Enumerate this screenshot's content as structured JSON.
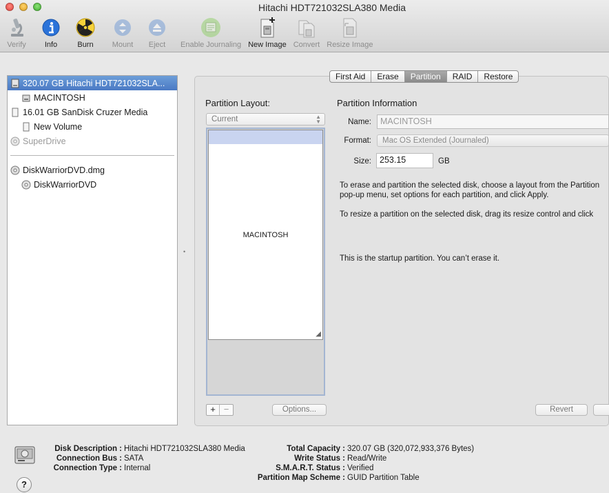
{
  "window": {
    "title": "Hitachi HDT721032SLA380 Media"
  },
  "toolbar": {
    "items": [
      {
        "label": "Verify",
        "icon": "microscope-icon",
        "enabled": false
      },
      {
        "label": "Info",
        "icon": "info-icon",
        "enabled": true
      },
      {
        "label": "Burn",
        "icon": "burn-radiation-icon",
        "enabled": true
      },
      {
        "label": "Mount",
        "icon": "mount-icon",
        "enabled": false
      },
      {
        "label": "Eject",
        "icon": "eject-icon",
        "enabled": false
      },
      {
        "label": "Enable Journaling",
        "icon": "journaling-icon",
        "enabled": false
      },
      {
        "label": "New Image",
        "icon": "new-image-icon",
        "enabled": true
      },
      {
        "label": "Convert",
        "icon": "convert-icon",
        "enabled": false
      },
      {
        "label": "Resize Image",
        "icon": "resize-image-icon",
        "enabled": false
      }
    ]
  },
  "sidebar": {
    "items": [
      {
        "label": "320.07 GB Hitachi HDT721032SLA...",
        "level": 0,
        "selected": true,
        "icon": "hard-disk-icon"
      },
      {
        "label": "MACINTOSH",
        "level": 1,
        "icon": "volume-icon"
      },
      {
        "label": "16.01 GB SanDisk Cruzer Media",
        "level": 0,
        "icon": "usb-disk-icon"
      },
      {
        "label": "New Volume",
        "level": 1,
        "icon": "volume-icon"
      },
      {
        "label": "SuperDrive",
        "level": 0,
        "dim": true,
        "icon": "optical-drive-icon"
      },
      {
        "label": "DiskWarriorDVD.dmg",
        "level": 0,
        "icon": "disk-image-icon"
      },
      {
        "label": "DiskWarriorDVD",
        "level": 1,
        "icon": "dvd-volume-icon"
      }
    ]
  },
  "tabs": [
    {
      "label": "First Aid",
      "active": false
    },
    {
      "label": "Erase",
      "active": false
    },
    {
      "label": "Partition",
      "active": true
    },
    {
      "label": "RAID",
      "active": false
    },
    {
      "label": "Restore",
      "active": false
    }
  ],
  "partition": {
    "layout_label": "Partition Layout:",
    "layout_select": "Current",
    "partitions": [
      {
        "name": "MACINTOSH"
      }
    ],
    "options_button": "Options...",
    "info_title": "Partition Information",
    "name_label": "Name:",
    "name_value": "MACINTOSH",
    "format_label": "Format:",
    "format_value": "Mac OS Extended (Journaled)",
    "size_label": "Size:",
    "size_value": "253.15",
    "size_unit": "GB",
    "help_text_1a": "To erase and partition the selected disk, choose a layout from the Partition",
    "help_text_1b": "pop-up menu, set options for each partition, and click Apply.",
    "help_text_2": "To resize a partition on the selected disk, drag its resize control and click",
    "startup_note": "This is the startup partition. You can’t erase it.",
    "revert_button": "Revert"
  },
  "disk_info": {
    "left": [
      {
        "key": "Disk Description",
        "value": "Hitachi HDT721032SLA380 Media"
      },
      {
        "key": "Connection Bus",
        "value": "SATA"
      },
      {
        "key": "Connection Type",
        "value": "Internal"
      }
    ],
    "right": [
      {
        "key": "Total Capacity",
        "value": "320.07 GB (320,072,933,376 Bytes)"
      },
      {
        "key": "Write Status",
        "value": "Read/Write"
      },
      {
        "key": "S.M.A.R.T. Status",
        "value": "Verified"
      },
      {
        "key": "Partition Map Scheme",
        "value": "GUID Partition Table"
      }
    ],
    "help_glyph": "?"
  }
}
